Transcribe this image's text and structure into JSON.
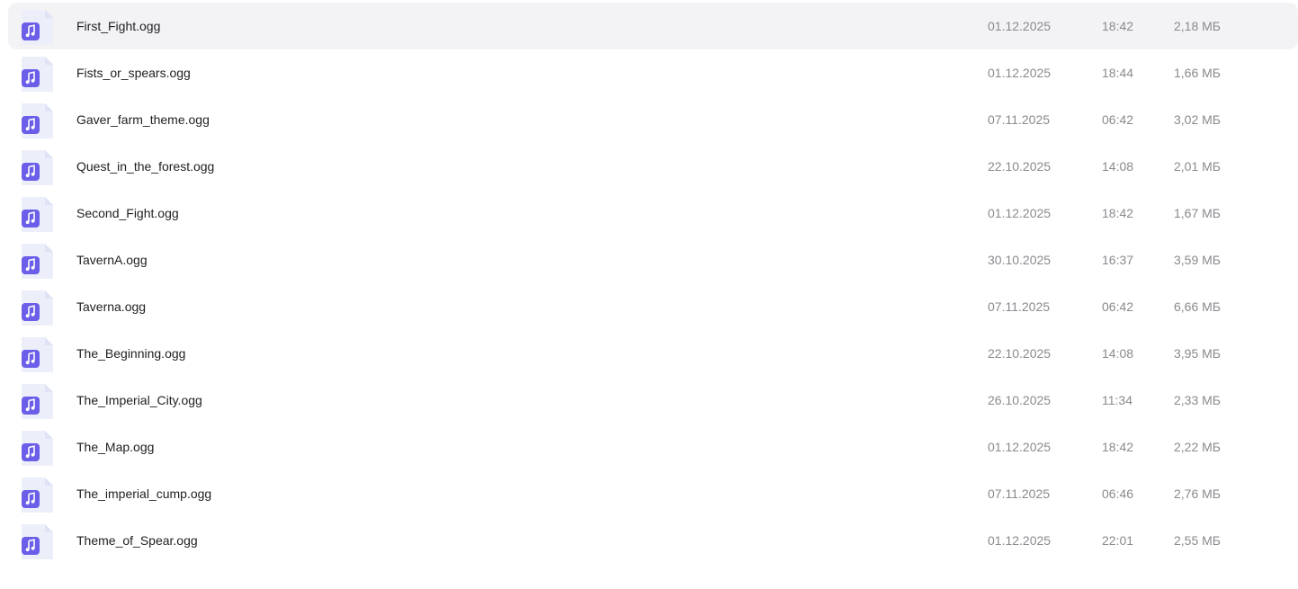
{
  "colors": {
    "icon_accent": "#6b5ee8",
    "icon_page": "#eceffa",
    "selected_row": "#f3f3f6",
    "meta_text": "#8a8a8f",
    "name_text": "#1f1f1f"
  },
  "file_icon": "audio-file-icon",
  "files": [
    {
      "name": "First_Fight.ogg",
      "date": "01.12.2025",
      "time": "18:42",
      "size": "2,18 МБ",
      "selected": true
    },
    {
      "name": "Fists_or_spears.ogg",
      "date": "01.12.2025",
      "time": "18:44",
      "size": "1,66 МБ"
    },
    {
      "name": "Gaver_farm_theme.ogg",
      "date": "07.11.2025",
      "time": "06:42",
      "size": "3,02 МБ"
    },
    {
      "name": "Quest_in_the_forest.ogg",
      "date": "22.10.2025",
      "time": "14:08",
      "size": "2,01 МБ"
    },
    {
      "name": "Second_Fight.ogg",
      "date": "01.12.2025",
      "time": "18:42",
      "size": "1,67 МБ"
    },
    {
      "name": "TavernA.ogg",
      "date": "30.10.2025",
      "time": "16:37",
      "size": "3,59 МБ"
    },
    {
      "name": "Taverna.ogg",
      "date": "07.11.2025",
      "time": "06:42",
      "size": "6,66 МБ"
    },
    {
      "name": "The_Beginning.ogg",
      "date": "22.10.2025",
      "time": "14:08",
      "size": "3,95 МБ"
    },
    {
      "name": "The_Imperial_City.ogg",
      "date": "26.10.2025",
      "time": "11:34",
      "size": "2,33 МБ"
    },
    {
      "name": "The_Map.ogg",
      "date": "01.12.2025",
      "time": "18:42",
      "size": "2,22 МБ"
    },
    {
      "name": "The_imperial_cump.ogg",
      "date": "07.11.2025",
      "time": "06:46",
      "size": "2,76 МБ"
    },
    {
      "name": "Theme_of_Spear.ogg",
      "date": "01.12.2025",
      "time": "22:01",
      "size": "2,55 МБ"
    }
  ]
}
